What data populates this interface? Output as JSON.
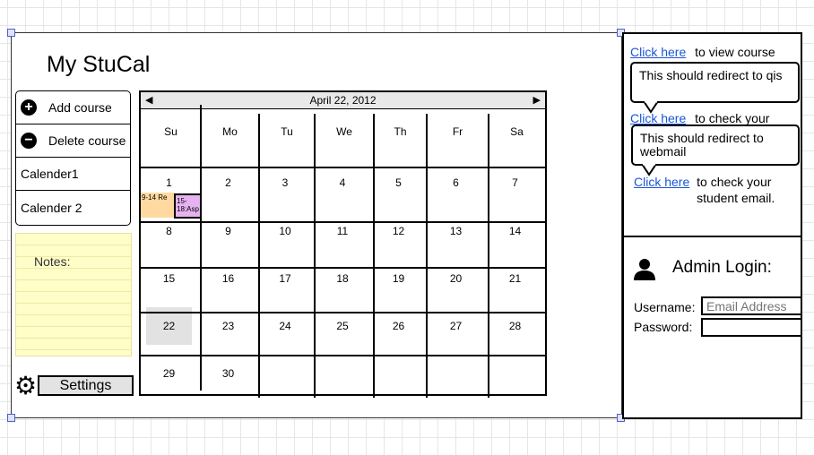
{
  "app": {
    "title": "My StuCal"
  },
  "menu": {
    "items": [
      {
        "label": "Add course",
        "icon": "plus-circle-icon"
      },
      {
        "label": "Delete course",
        "icon": "minus-circle-icon"
      },
      {
        "label": "Calender1"
      },
      {
        "label": "Calender 2"
      }
    ]
  },
  "notes": {
    "label": "Notes:"
  },
  "settings": {
    "label": "Settings",
    "icon": "gear-icon"
  },
  "calendar": {
    "month_label": "April 22, 2012",
    "weekdays": [
      "Su",
      "Mo",
      "Tu",
      "We",
      "Th",
      "Fr",
      "Sa"
    ],
    "weeks": [
      [
        "1",
        "2",
        "3",
        "4",
        "5",
        "6",
        "7"
      ],
      [
        "8",
        "9",
        "10",
        "11",
        "12",
        "13",
        "14"
      ],
      [
        "15",
        "16",
        "17",
        "18",
        "19",
        "20",
        "21"
      ],
      [
        "22",
        "23",
        "24",
        "25",
        "26",
        "27",
        "28"
      ],
      [
        "29",
        "30",
        "",
        "",
        "",
        "",
        ""
      ]
    ],
    "events": [
      {
        "text": "9-14 Re",
        "color": "#ffd9a0"
      },
      {
        "text": "15-18:Asp",
        "color": "#e6b3f0"
      }
    ]
  },
  "links": {
    "course": {
      "link": "Click here",
      "text": "to view course",
      "bubble": "This should redirect to qis"
    },
    "check": {
      "link": "Click here",
      "text": "to check your",
      "bubble": "This should redirect to webmail"
    },
    "email": {
      "link": "Click here",
      "text": "to check your student email."
    }
  },
  "admin": {
    "title": "Admin Login:",
    "username_label": "Username:",
    "username_placeholder": "Email Address",
    "password_label": "Password:"
  }
}
